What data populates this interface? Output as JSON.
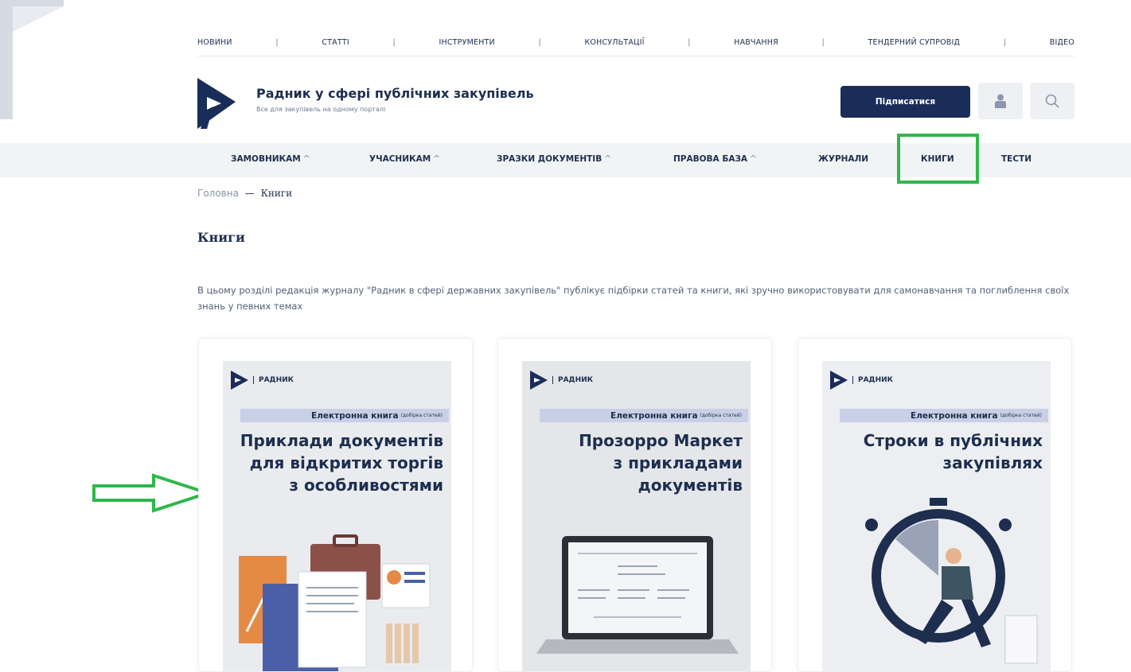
{
  "top_nav": [
    "НОВИНИ",
    "СТАТТІ",
    "ІНСТРУМЕНТИ",
    "КОНСУЛЬТАЦІЇ",
    "НАВЧАННЯ",
    "ТЕНДЕРНИЙ СУПРОВІД",
    "ВІДЕО"
  ],
  "header": {
    "site_title": "Радник у сфері публічних закупівель",
    "site_subtitle": "Все для закупівель на одному порталі",
    "subscribe_label": "Підписатися"
  },
  "main_nav": [
    {
      "label": "ЗАМОВНИКАМ",
      "caret": "^"
    },
    {
      "label": "УЧАСНИКАМ",
      "caret": "^"
    },
    {
      "label": "ЗРАЗКИ ДОКУМЕНТІВ",
      "caret": "^"
    },
    {
      "label": "ПРАВОВА БАЗА",
      "caret": "^"
    },
    {
      "label": "ЖУРНАЛИ",
      "caret": ""
    },
    {
      "label": "КНИГИ",
      "caret": ""
    },
    {
      "label": "ТЕСТИ",
      "caret": ""
    }
  ],
  "breadcrumb": {
    "home": "Головна",
    "separator": "—",
    "current": "Книги"
  },
  "page": {
    "title": "Книги",
    "intro": "В цьому розділі редакція журналу \"Радник в сфері державних закупівель\" публікує підбірки статей та книги, які зручно використовувати для самонавчання та поглиблення своїх знань у певних темах"
  },
  "books": [
    {
      "brand": "РАДНИК",
      "band": "Електронна книга",
      "band_small": "(добірка статей)",
      "title_lines": [
        "Приклади документів",
        "для відкритих торгів",
        "з особливостями"
      ],
      "illustration": "office-documents"
    },
    {
      "brand": "РАДНИК",
      "band": "Електронна книга",
      "band_small": "(добірка статей)",
      "title_lines": [
        "Прозорро Маркет",
        "з прикладами",
        "документів"
      ],
      "illustration": "laptop"
    },
    {
      "brand": "РАДНИК",
      "band": "Електронна книга",
      "band_small": "(добірка статей)",
      "title_lines": [
        "Строки в публічних",
        "закупівлях"
      ],
      "illustration": "stopwatch-runner"
    }
  ],
  "colors": {
    "brand_navy": "#1a2d59",
    "highlight_green": "#2eb84a",
    "nav_bg": "#f1f4f5"
  }
}
